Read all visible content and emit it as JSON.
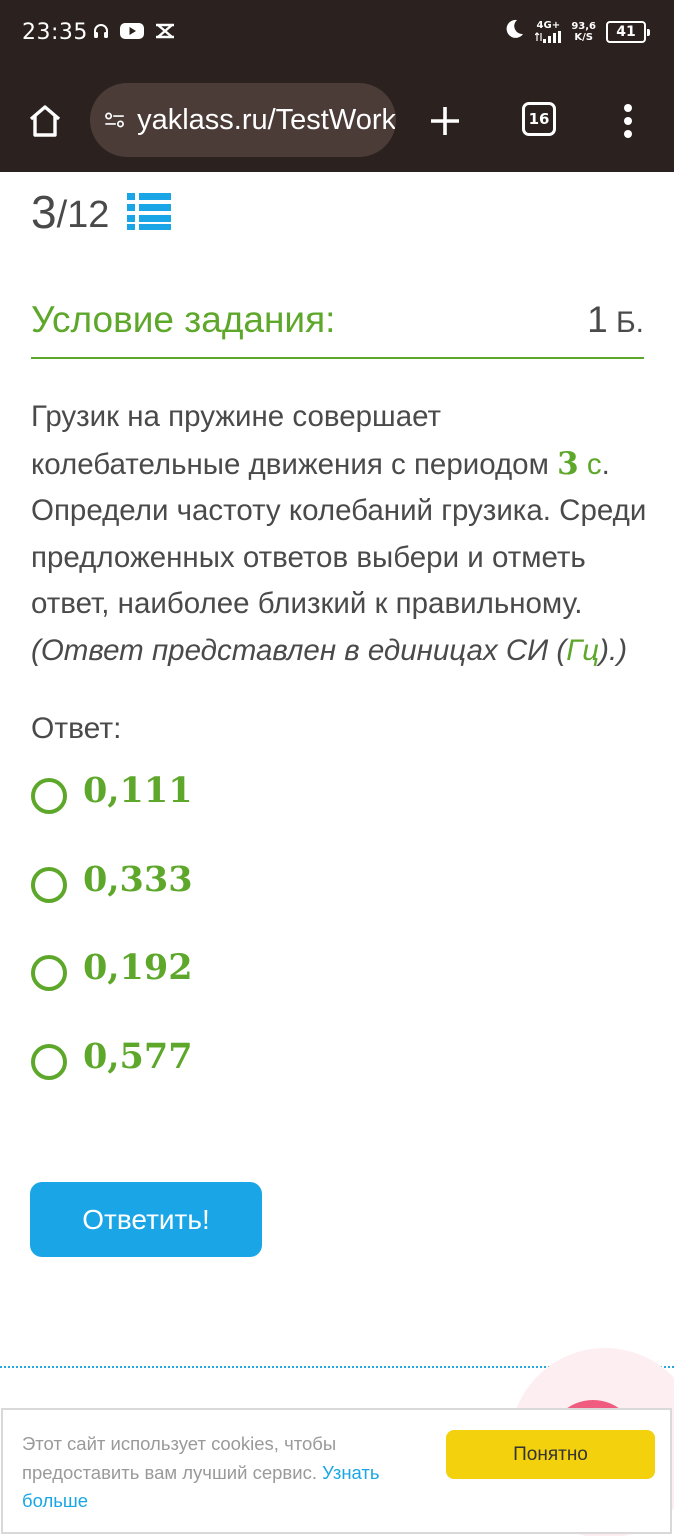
{
  "status_bar": {
    "time": "23:35",
    "network": "4G+",
    "speed_value": "93,6",
    "speed_unit": "K/S",
    "battery": "41",
    "icons": [
      "headset-icon",
      "youtube-icon",
      "capcut-icon",
      "moon-icon",
      "signal-icon"
    ]
  },
  "browser": {
    "url": "yaklass.ru/TestWork",
    "tab_count": "16",
    "icons": [
      "home-icon",
      "site-settings-icon",
      "plus-icon",
      "more-vert-icon"
    ]
  },
  "progress": {
    "current": "3",
    "total": "/12"
  },
  "section": {
    "title": "Условие задания:",
    "points": "1",
    "points_unit": " Б."
  },
  "task": {
    "line1_pre": "Грузик на пружине совершает колебательные движения с периодом ",
    "period_value": "3",
    "period_unit": " с",
    "line1_post": ". Определи частоту колебаний грузика. Среди предложенных ответов выбери и отметь ответ, наиболее близкий к правильному.",
    "note_pre": "(Ответ представлен в единицах СИ (",
    "note_unit": "Гц",
    "note_post": ").)"
  },
  "answer": {
    "label": "Ответ:",
    "options": [
      "0,111",
      "0,333",
      "0,192",
      "0,577"
    ]
  },
  "submit_label": "Ответить!",
  "cookie": {
    "text": "Этот сайт использует cookies, чтобы предоставить вам лучший сервис. ",
    "link": "Узнать больше",
    "button": "Понятно"
  },
  "colors": {
    "accent_green": "#5da72a",
    "button_blue": "#1aa6e6",
    "cookie_yellow": "#f3d10d",
    "toolbar_dark": "#2b211f"
  }
}
